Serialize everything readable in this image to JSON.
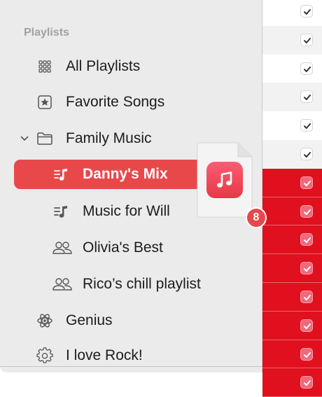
{
  "sidebar": {
    "section_title": "Playlists",
    "items": [
      {
        "label": "All Playlists",
        "icon": "grid-icon"
      },
      {
        "label": "Favorite Songs",
        "icon": "star-box-icon"
      },
      {
        "label": "Family Music",
        "icon": "folder-icon",
        "expanded": true
      },
      {
        "label": "Danny's Mix",
        "icon": "playlist-icon",
        "selected": true
      },
      {
        "label": "Music for Will",
        "icon": "playlist-icon"
      },
      {
        "label": "Olivia's Best",
        "icon": "shared-people-icon"
      },
      {
        "label": "Rico’s chill playlist",
        "icon": "shared-people-icon"
      },
      {
        "label": "Genius",
        "icon": "atom-icon"
      },
      {
        "label": "I love Rock!",
        "icon": "smart-gear-icon"
      }
    ]
  },
  "drag": {
    "count": "8",
    "icon": "music-note-app-icon"
  },
  "tracks": {
    "rows": [
      "white",
      "gray",
      "white",
      "gray",
      "white",
      "gray",
      "red",
      "red",
      "red",
      "red",
      "red",
      "red",
      "red",
      "red"
    ]
  },
  "colors": {
    "selection": "#e9484a",
    "selected_tracks": "#e0101f",
    "badge": "#e5484d"
  }
}
